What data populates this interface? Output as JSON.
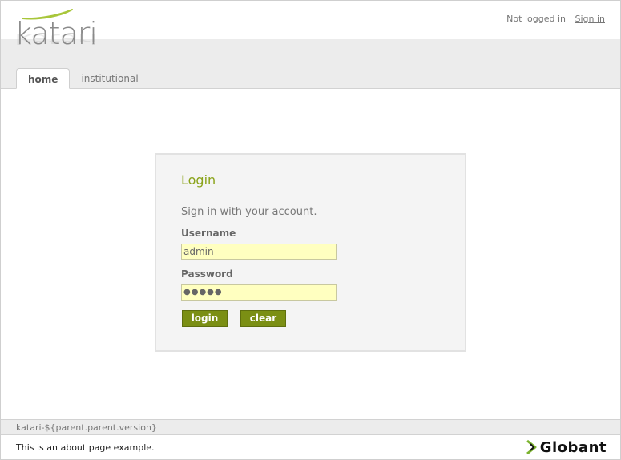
{
  "brand": {
    "logo_text": "katari",
    "logo_color": "#a8c63a"
  },
  "session": {
    "status": "Not logged in",
    "signin_label": "Sign in"
  },
  "tabs": [
    {
      "label": "home",
      "active": true
    },
    {
      "label": "institutional",
      "active": false
    }
  ],
  "login": {
    "title": "Login",
    "subtitle": "Sign in with your account.",
    "username_label": "Username",
    "username_value": "admin",
    "password_label": "Password",
    "password_value": "●●●●●",
    "login_button": "login",
    "clear_button": "clear"
  },
  "footer": {
    "version": "katari-${parent.parent.version}",
    "about": "This is an about page example.",
    "sponsor": "Globant"
  },
  "colors": {
    "accent": "#8aa31a",
    "button": "#7b8f14",
    "field_bg": "#ffffc0"
  }
}
